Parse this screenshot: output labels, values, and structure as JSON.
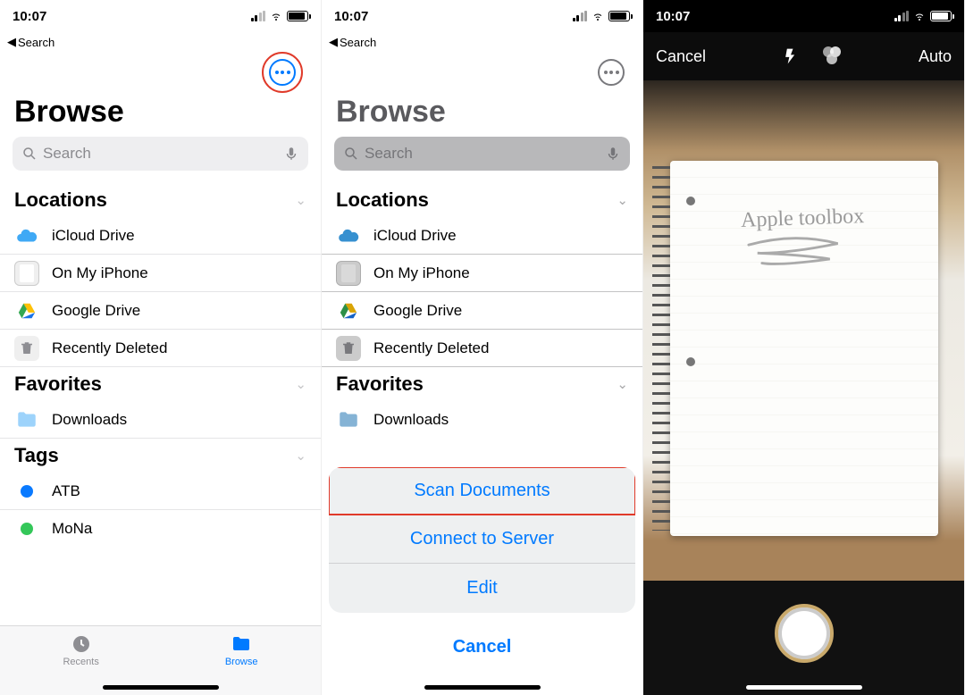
{
  "status": {
    "time": "10:07"
  },
  "back_link": {
    "label": "Search"
  },
  "title": "Browse",
  "search": {
    "placeholder": "Search"
  },
  "sections": {
    "locations": {
      "header": "Locations",
      "items": [
        {
          "label": "iCloud Drive"
        },
        {
          "label": "On My iPhone"
        },
        {
          "label": "Google Drive"
        },
        {
          "label": "Recently Deleted"
        }
      ]
    },
    "favorites": {
      "header": "Favorites",
      "items": [
        {
          "label": "Downloads"
        }
      ]
    },
    "tags": {
      "header": "Tags",
      "items": [
        {
          "label": "ATB",
          "color": "#0a7aff"
        },
        {
          "label": "MoNa",
          "color": "#34c759"
        }
      ]
    }
  },
  "tabs": {
    "recents": "Recents",
    "browse": "Browse"
  },
  "action_sheet": {
    "scan": "Scan Documents",
    "connect": "Connect to Server",
    "edit": "Edit",
    "cancel": "Cancel"
  },
  "camera": {
    "cancel": "Cancel",
    "auto": "Auto",
    "notebook_text": "Apple toolbox"
  }
}
